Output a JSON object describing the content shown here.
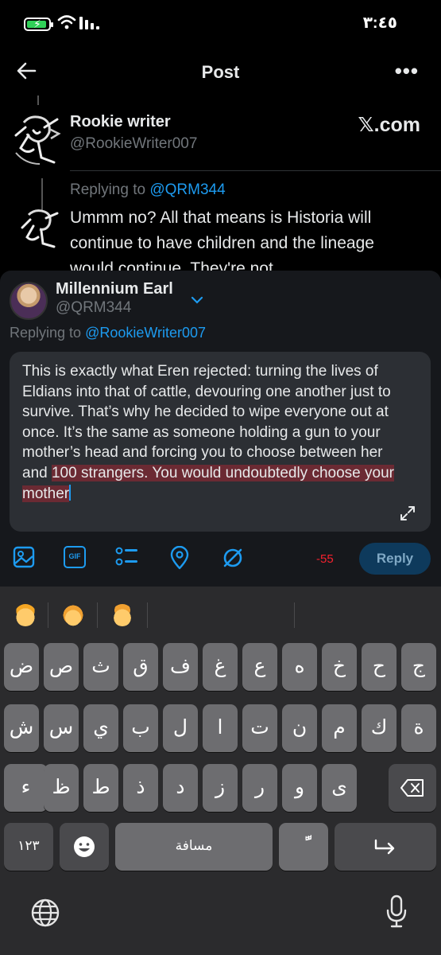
{
  "status_bar": {
    "time": "٣:٤٥"
  },
  "header": {
    "title": "Post"
  },
  "original_post": {
    "author_name": "Rookie writer",
    "author_handle": "@RookieWriter007",
    "brand": "𝕏.com",
    "replying_to_label": "Replying to ",
    "replying_to_handle": "@QRM344",
    "text": "Ummm no? All that means is Historia will continue to have children and the lineage would continue. They're not"
  },
  "composer": {
    "author_name": "Millennium Earl",
    "author_handle": "@QRM344",
    "replying_to_label": "Replying to ",
    "replying_to_handle": "@RookieWriter007",
    "text_plain": "This is exactly what Eren rejected: turning the lives of Eldians into that of cattle, devouring one another just to survive. That’s why he decided to wipe everyone out at once. It’s the same as someone holding a gun to your mother’s head and forcing you to choose between her and ",
    "text_highlighted": "100 strangers. You would undoubtedly choose your mother",
    "char_count": "-55",
    "reply_label": "Reply"
  },
  "toolbar": {
    "icons": [
      "image-icon",
      "gif-icon",
      "poll-icon",
      "location-icon",
      "circle-slash-icon"
    ],
    "gif_label": "GIF"
  },
  "keyboard": {
    "suggestions": [
      "emoji-boy",
      "emoji-woman",
      "emoji-man"
    ],
    "row1": [
      "ض",
      "ص",
      "ث",
      "ق",
      "ف",
      "غ",
      "ع",
      "ه",
      "خ",
      "ح",
      "ج"
    ],
    "row2": [
      "ش",
      "س",
      "ي",
      "ب",
      "ل",
      "ا",
      "ت",
      "ن",
      "م",
      "ك",
      "ة"
    ],
    "row3": [
      "ء",
      "ظ",
      "ط",
      "ذ",
      "د",
      "ز",
      "ر",
      "و",
      "ى"
    ],
    "numbers_key": "١٢٣",
    "space_label": "مسافة",
    "diacritic_key": "ًّ"
  },
  "colors": {
    "accent": "#1d9bf0",
    "background": "#000000",
    "composer_bg": "#16181c",
    "textbox_bg": "#2c2f34",
    "selection": "#6b2a33",
    "warning": "#f4212e",
    "battery": "#30d158"
  }
}
